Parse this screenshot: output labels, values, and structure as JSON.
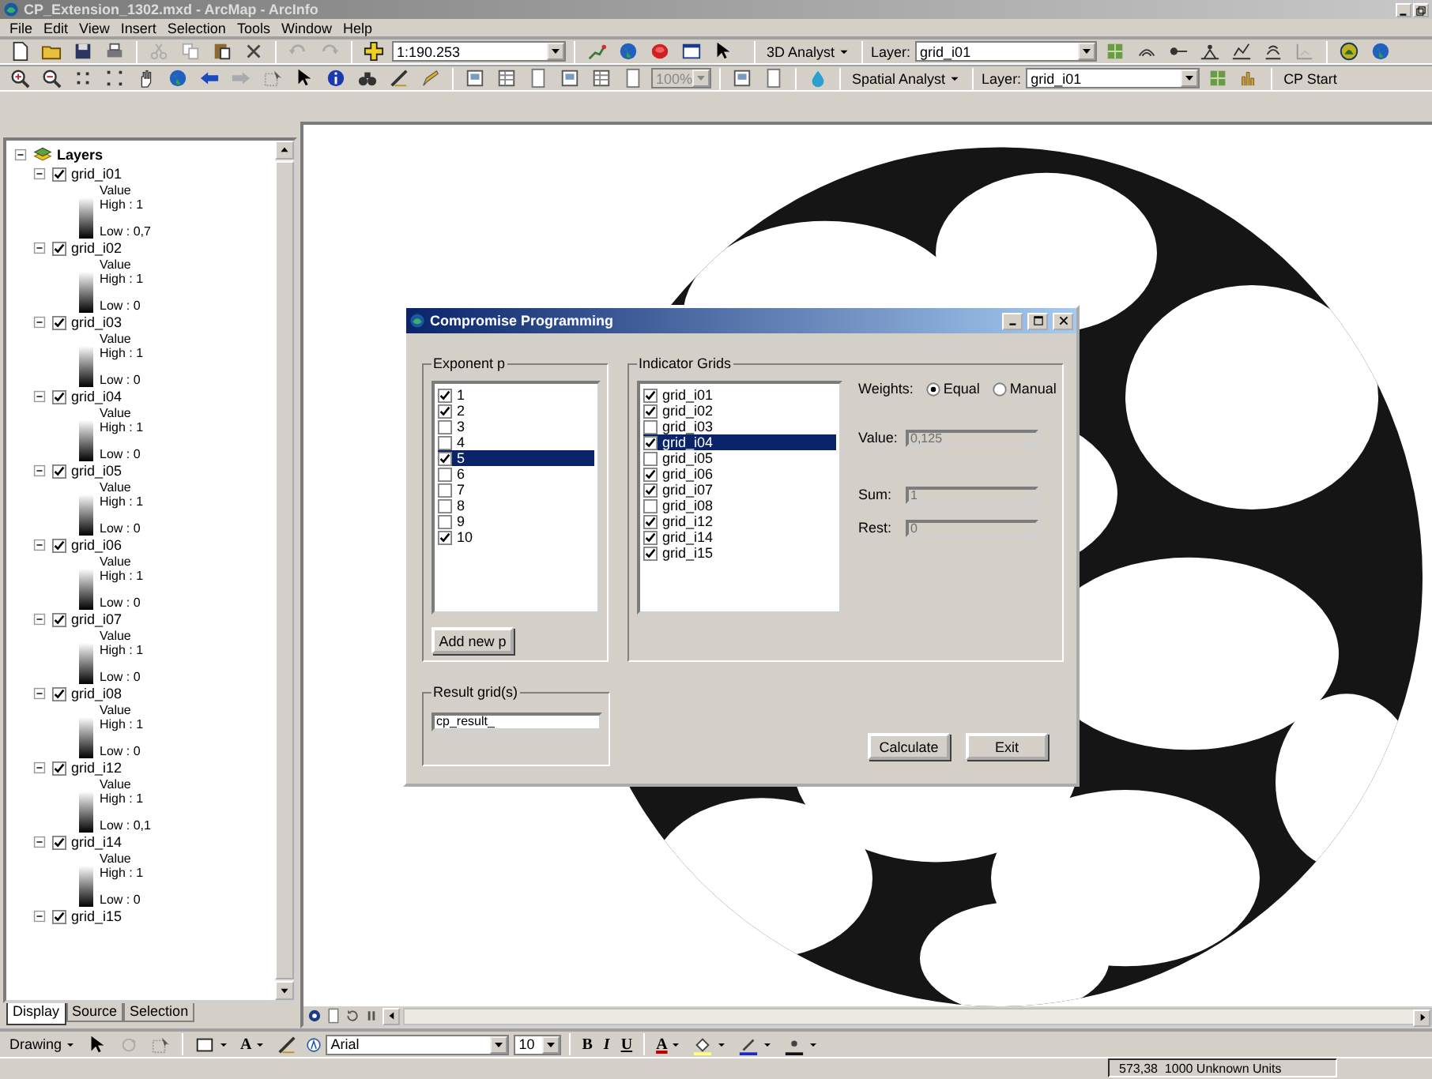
{
  "window": {
    "title": "CP_Extension_1302.mxd - ArcMap - ArcInfo"
  },
  "menu": [
    "File",
    "Edit",
    "View",
    "Insert",
    "Selection",
    "Tools",
    "Window",
    "Help"
  ],
  "standard_toolbar": {
    "scale": "1:190.253",
    "extension_menu": "3D Analyst",
    "layer_label": "Layer:",
    "layer": "grid_i01"
  },
  "spatial_toolbar": {
    "zoom": "100%",
    "extension_menu": "Spatial Analyst",
    "layer_label": "Layer:",
    "layer": "grid_i01",
    "button": "CP Start"
  },
  "toc": {
    "root": "Layers",
    "layers": [
      {
        "name": "grid_i01",
        "checked": true,
        "field": "Value",
        "high": "High : 1",
        "low": "Low : 0,7"
      },
      {
        "name": "grid_i02",
        "checked": true,
        "field": "Value",
        "high": "High : 1",
        "low": "Low : 0"
      },
      {
        "name": "grid_i03",
        "checked": true,
        "field": "Value",
        "high": "High : 1",
        "low": "Low : 0"
      },
      {
        "name": "grid_i04",
        "checked": true,
        "field": "Value",
        "high": "High : 1",
        "low": "Low : 0"
      },
      {
        "name": "grid_i05",
        "checked": true,
        "field": "Value",
        "high": "High : 1",
        "low": "Low : 0"
      },
      {
        "name": "grid_i06",
        "checked": true,
        "field": "Value",
        "high": "High : 1",
        "low": "Low : 0"
      },
      {
        "name": "grid_i07",
        "checked": true,
        "field": "Value",
        "high": "High : 1",
        "low": "Low : 0"
      },
      {
        "name": "grid_i08",
        "checked": true,
        "field": "Value",
        "high": "High : 1",
        "low": "Low : 0"
      },
      {
        "name": "grid_i12",
        "checked": true,
        "field": "Value",
        "high": "High : 1",
        "low": "Low : 0,1"
      },
      {
        "name": "grid_i14",
        "checked": true,
        "field": "Value",
        "high": "High : 1",
        "low": "Low : 0"
      },
      {
        "name": "grid_i15",
        "checked": true
      }
    ]
  },
  "toc_tabs": [
    {
      "label": "Display",
      "selected": true
    },
    {
      "label": "Source",
      "selected": false
    },
    {
      "label": "Selection",
      "selected": false
    }
  ],
  "dialog": {
    "title": "Compromise Programming",
    "exponent": {
      "label": "Exponent p",
      "items": [
        {
          "label": "1",
          "checked": true,
          "selected": false
        },
        {
          "label": "2",
          "checked": true,
          "selected": false
        },
        {
          "label": "3",
          "checked": false,
          "selected": false
        },
        {
          "label": "4",
          "checked": false,
          "selected": false
        },
        {
          "label": "5",
          "checked": true,
          "selected": true
        },
        {
          "label": "6",
          "checked": false,
          "selected": false
        },
        {
          "label": "7",
          "checked": false,
          "selected": false
        },
        {
          "label": "8",
          "checked": false,
          "selected": false
        },
        {
          "label": "9",
          "checked": false,
          "selected": false
        },
        {
          "label": "10",
          "checked": true,
          "selected": false
        }
      ],
      "add_button": "Add new p"
    },
    "indicators": {
      "label": "Indicator Grids",
      "items": [
        {
          "label": "grid_i01",
          "checked": true,
          "selected": false
        },
        {
          "label": "grid_i02",
          "checked": true,
          "selected": false
        },
        {
          "label": "grid_i03",
          "checked": false,
          "selected": false
        },
        {
          "label": "grid_i04",
          "checked": true,
          "selected": true
        },
        {
          "label": "grid_i05",
          "checked": false,
          "selected": false
        },
        {
          "label": "grid_i06",
          "checked": true,
          "selected": false
        },
        {
          "label": "grid_i07",
          "checked": true,
          "selected": false
        },
        {
          "label": "grid_i08",
          "checked": false,
          "selected": false
        },
        {
          "label": "grid_i12",
          "checked": true,
          "selected": false
        },
        {
          "label": "grid_i14",
          "checked": true,
          "selected": false
        },
        {
          "label": "grid_i15",
          "checked": true,
          "selected": false
        }
      ]
    },
    "weights": {
      "label": "Weights:",
      "options": [
        {
          "label": "Equal",
          "selected": true
        },
        {
          "label": "Manual",
          "selected": false
        }
      ]
    },
    "fields": [
      {
        "label": "Value:",
        "value": "0,125",
        "disabled": true
      },
      {
        "label": "Sum:",
        "value": "1",
        "disabled": true
      },
      {
        "label": "Rest:",
        "value": "0",
        "disabled": true
      }
    ],
    "result": {
      "label": "Result grid(s)",
      "value": "cp_result_"
    },
    "buttons": [
      "Calculate",
      "Exit"
    ]
  },
  "drawing_toolbar": {
    "menu": "Drawing",
    "text_tool": "A",
    "font": "Arial",
    "size": "10",
    "bold": "B",
    "italic": "I",
    "underline": "U",
    "font_color": "A"
  },
  "status_bar": {
    "coordinates": "573,38  1000 Unknown Units"
  }
}
